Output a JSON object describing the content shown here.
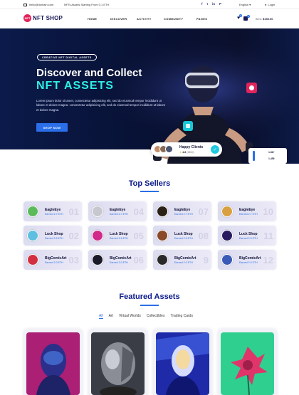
{
  "topbar": {
    "email": "hello@domain.com",
    "promo": "NFTs Assets Starting From 0.1 ETH",
    "socials": [
      "f",
      "t",
      "in",
      "P"
    ],
    "language": "English",
    "login": "Login"
  },
  "header": {
    "logo_mark": "NFT",
    "logo_text": "NFT SHOP",
    "nav": [
      "HOME",
      "DISCOVER",
      "ACTIVITY",
      "COMMUNITY",
      "PAGES"
    ],
    "wishlist_count": "0",
    "cart_count": "0",
    "cart_label": "Item:",
    "cart_total": "$150.00"
  },
  "hero": {
    "tag": "CREATIVE NFT DIGITAL ASSETS",
    "title_line1": "Discover and Collect",
    "title_line2": "NFT ASSETS",
    "description": "Lorem ipsum dolor sit amet, consectetur adipisicing elit, sed do eiusmod tempor incididunt ut labore et dolore magna. consectetur adipisicing elit, sed do eiusmod tempor incididunt ut labore et dolore magna.",
    "button": "SHOP NOW",
    "happy_clients": {
      "title": "Happy Clients",
      "rating": "4.8",
      "rating_count": "(3800)"
    },
    "stats": {
      "value1": "1.8k+",
      "value2": "1,456"
    }
  },
  "top_sellers": {
    "title": "Top Sellers",
    "sellers": [
      {
        "name": "EagleEye",
        "earned": "Earned 2.7 ETH",
        "rank": "01"
      },
      {
        "name": "EagleEye",
        "earned": "Earned 2.7 ETH",
        "rank": "04"
      },
      {
        "name": "EagleEye",
        "earned": "Earned 2.7 ETH",
        "rank": "07"
      },
      {
        "name": "EagleEye",
        "earned": "Earned 2.7 ETH",
        "rank": "10"
      },
      {
        "name": "Luck Shop",
        "earned": "Earned 2.5 ETH",
        "rank": "02"
      },
      {
        "name": "Luck Shop",
        "earned": "Earned 2.5 ETH",
        "rank": "05"
      },
      {
        "name": "Luck Shop",
        "earned": "Earned 2.5 ETH",
        "rank": "08"
      },
      {
        "name": "Luck Shop",
        "earned": "Earned 2.5 ETH",
        "rank": "11"
      },
      {
        "name": "BigComicArt",
        "earned": "Earned 2.0 ETH",
        "rank": "03"
      },
      {
        "name": "BigComicArt",
        "earned": "Earned 2.0 ETH",
        "rank": "06"
      },
      {
        "name": "BigComicArt",
        "earned": "Earned 2.0 ETH",
        "rank": "9"
      },
      {
        "name": "BigComicArt",
        "earned": "Earned 2.0 ETH",
        "rank": "12"
      }
    ]
  },
  "featured": {
    "title": "Featured Assets",
    "filters": [
      "All",
      "Art",
      "Virtual Worlds",
      "Collectibles",
      "Trading Cards"
    ],
    "active_filter": "All"
  },
  "colors": {
    "accent": "#2a6fe8",
    "title_blue": "#0a1a8a",
    "hero_cyan": "#2ef0e6",
    "logo_pink": "#e3245b"
  }
}
